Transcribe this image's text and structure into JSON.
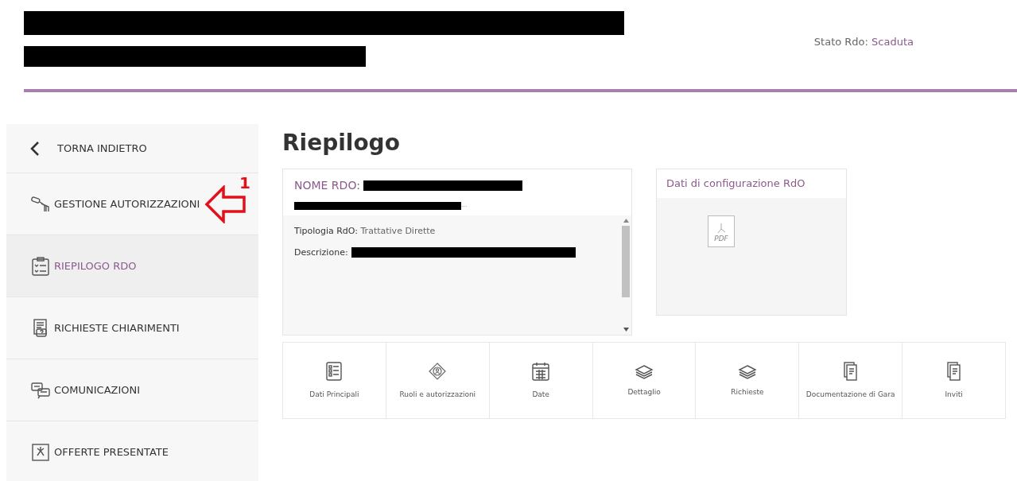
{
  "header": {
    "status_label": "Stato Rdo:",
    "status_value": "Scaduta"
  },
  "sidebar": {
    "items": [
      {
        "kind": "back",
        "label": "TORNA INDIETRO",
        "selected": false
      },
      {
        "kind": "item",
        "label": "GESTIONE AUTORIZZAZIONI",
        "selected": false
      },
      {
        "kind": "item",
        "label": "RIEPILOGO RDO",
        "selected": true
      },
      {
        "kind": "item",
        "label": "RICHIESTE CHIARIMENTI",
        "selected": false
      },
      {
        "kind": "item",
        "label": "COMUNICAZIONI",
        "selected": false
      },
      {
        "kind": "item",
        "label": "OFFERTE PRESENTATE",
        "selected": false
      }
    ]
  },
  "annotation": {
    "number": "1"
  },
  "main": {
    "title": "Riepilogo",
    "summary_card": {
      "name_label": "NOME RDO:",
      "name_ellipsis": "...",
      "fields": [
        {
          "label": "Tipologia RdO:",
          "value": "Trattative Dirette"
        },
        {
          "label": "Descrizione:"
        }
      ]
    },
    "config_card": {
      "title": "Dati di configurazione RdO",
      "file_label": "PDF"
    },
    "tiles": [
      {
        "label": "Dati Principali"
      },
      {
        "label": "Ruoli e autorizzazioni"
      },
      {
        "label": "Date"
      },
      {
        "label": "Dettaglio"
      },
      {
        "label": "Richieste"
      },
      {
        "label": "Documentazione di Gara"
      },
      {
        "label": "Inviti"
      }
    ]
  }
}
